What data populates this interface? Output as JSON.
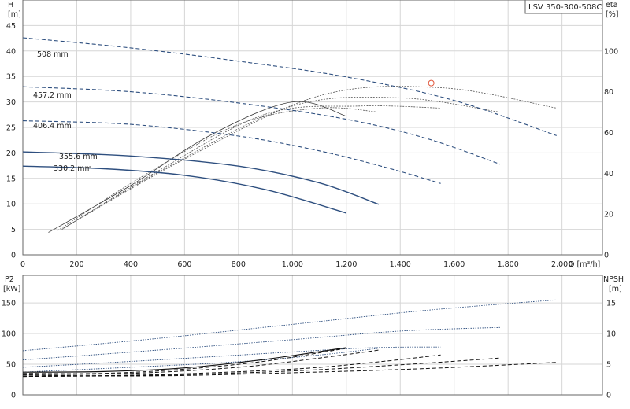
{
  "header": {
    "model": "LSV 350-300-508C"
  },
  "axes": {
    "top_left_label": "H",
    "top_left_unit": "[m]",
    "top_right_label": "eta",
    "top_right_unit": "[%]",
    "bottom_left_label": "P2",
    "bottom_left_unit": "[kW]",
    "bottom_right_label": "NPSH",
    "bottom_right_unit": "[m]",
    "x_label": "Q [m³/h]"
  },
  "chart_data": [
    {
      "type": "line",
      "panel": "head-efficiency",
      "xlim": [
        0,
        2150
      ],
      "ylim": [
        0,
        50
      ],
      "y2lim": [
        0,
        125
      ],
      "x_ticks": [
        0,
        200,
        400,
        600,
        800,
        1000,
        1200,
        1400,
        1600,
        1800,
        2000
      ],
      "x_tick_labels": [
        "0",
        "200",
        "400",
        "600",
        "800",
        "1,000",
        "1,200",
        "1,400",
        "1,600",
        "1,800",
        "2,000"
      ],
      "y_ticks": [
        0,
        5,
        10,
        15,
        20,
        25,
        30,
        35,
        40,
        45
      ],
      "y2_ticks": [
        0,
        20,
        40,
        60,
        80,
        100
      ],
      "grid": true,
      "head_curves": [
        {
          "name": "508 mm",
          "x": [
            0,
            400,
            800,
            1200,
            1600,
            1980
          ],
          "y": [
            42.6,
            40.6,
            38.0,
            34.9,
            30.3,
            23.4
          ]
        },
        {
          "name": "457.2 mm",
          "x": [
            0,
            400,
            800,
            1200,
            1500,
            1770
          ],
          "y": [
            33.0,
            32.0,
            29.8,
            26.6,
            22.8,
            17.8
          ]
        },
        {
          "name": "406.4 mm",
          "x": [
            0,
            400,
            800,
            1100,
            1350,
            1550
          ],
          "y": [
            26.3,
            25.6,
            23.3,
            20.4,
            17.1,
            14.0
          ]
        },
        {
          "name": "355.6 mm",
          "x": [
            0,
            400,
            800,
            1100,
            1320
          ],
          "y": [
            20.2,
            19.4,
            17.4,
            14.1,
            9.9
          ]
        },
        {
          "name": "330.2 mm",
          "x": [
            0,
            300,
            600,
            900,
            1200
          ],
          "y": [
            17.4,
            16.9,
            15.6,
            12.8,
            8.2
          ]
        }
      ],
      "efficiency_curves": [
        {
          "x": [
            95,
            400,
            700,
            1000,
            1200
          ],
          "y": [
            11,
            34,
            59,
            75,
            68
          ]
        },
        {
          "x": [
            130,
            450,
            800,
            1100,
            1320
          ],
          "y": [
            12,
            39,
            64,
            72,
            70
          ]
        },
        {
          "x": [
            145,
            500,
            900,
            1250,
            1550
          ],
          "y": [
            12.5,
            41,
            69,
            73,
            72
          ]
        },
        {
          "x": [
            150,
            550,
            1000,
            1400,
            1770
          ],
          "y": [
            13,
            44,
            73,
            77,
            70
          ]
        },
        {
          "x": [
            150,
            600,
            1100,
            1550,
            1980
          ],
          "y": [
            13,
            47,
            78,
            82,
            72
          ]
        }
      ],
      "efficiency_ticks_left_unit": "eta",
      "operating_point": {
        "x": 1515,
        "y": 33.7
      }
    },
    {
      "type": "line",
      "panel": "power-npsh",
      "xlim": [
        0,
        2150
      ],
      "ylim": [
        0,
        195
      ],
      "y2lim": [
        0,
        19.5
      ],
      "y_ticks": [
        0,
        50,
        100,
        150
      ],
      "y2_ticks": [
        0,
        5,
        10,
        15
      ],
      "grid": true,
      "power_curves": [
        {
          "x": [
            0,
            500,
            1000,
            1500,
            1980
          ],
          "y": [
            72,
            92,
            115,
            138,
            155
          ]
        },
        {
          "x": [
            0,
            500,
            1000,
            1400,
            1770
          ],
          "y": [
            57,
            73,
            90,
            104,
            110
          ]
        },
        {
          "x": [
            0,
            500,
            1000,
            1300,
            1550
          ],
          "y": [
            45,
            57,
            70,
            77,
            78
          ]
        },
        {
          "x": [
            0,
            400,
            800,
            1100,
            1320
          ],
          "y": [
            37,
            45,
            54,
            65,
            76
          ]
        },
        {
          "x": [
            0,
            300,
            600,
            900,
            1200
          ],
          "y": [
            37,
            38,
            44,
            58,
            77
          ]
        }
      ],
      "npsh_curves": [
        {
          "x": [
            0,
            500,
            1000,
            1500,
            1980
          ],
          "y": [
            3.2,
            3.1,
            3.6,
            4.3,
            5.3
          ]
        },
        {
          "x": [
            0,
            500,
            1000,
            1400,
            1770
          ],
          "y": [
            3.0,
            3.2,
            3.9,
            4.9,
            6.0
          ]
        },
        {
          "x": [
            0,
            500,
            1000,
            1300,
            1550
          ],
          "y": [
            3.0,
            3.3,
            4.2,
            5.3,
            6.5
          ]
        },
        {
          "x": [
            0,
            400,
            800,
            1100,
            1320
          ],
          "y": [
            3.3,
            3.5,
            4.5,
            6.0,
            7.3
          ]
        },
        {
          "x": [
            0,
            300,
            600,
            900,
            1200
          ],
          "y": [
            3.5,
            3.5,
            4.2,
            5.5,
            7.6
          ]
        }
      ]
    }
  ]
}
